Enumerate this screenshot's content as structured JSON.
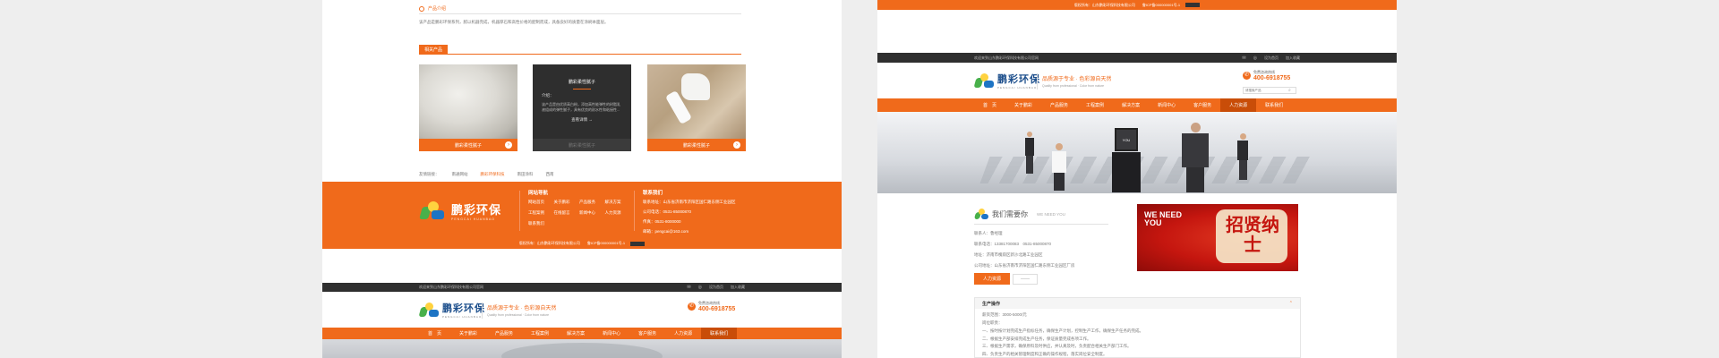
{
  "colors": {
    "brand_orange": "#f06a1b",
    "dark_orange": "#c94d08",
    "topbar": "#2f2f2f",
    "green": "#48b04a",
    "blue": "#1d74c4",
    "red": "#d9261c"
  },
  "left": {
    "section_title": "产品介绍",
    "section_text": "该产品是鹏彩环保系列，腻以机器完成，机器厚石和高性价格的配制而成，具备良好的质量在涂刷本面层。",
    "related_title": "相关产品",
    "products": [
      {
        "label": "鹏彩柔性腻子",
        "icon": "arrow-right-icon"
      },
      {
        "title": "鹏彩柔性腻子",
        "intro": "介绍：",
        "desc": "该产品是由优质高白粉，添加高性能弹性的树脂乳液组成的弹性腻子，具有优良的耐水性和粘接性...",
        "more": "查看详情 →",
        "label": "鹏彩柔性腻子"
      },
      {
        "label": "鹏彩柔性腻子",
        "icon": "arrow-right-icon"
      }
    ],
    "breadcrumb": [
      "友情链接：",
      "南通网站",
      "鹏彩环保科技",
      "南田涂料",
      "西南"
    ],
    "footer": {
      "logo_text": "鹏彩环保",
      "logo_sub": "PENGCAI HUANBAO",
      "nav_title": "网站导航",
      "nav_links": [
        "网站首页",
        "关于鹏彩",
        "产品服务",
        "解决方案",
        "工程案例",
        "在线留言",
        "新闻中心",
        "人力资源",
        "联系我们"
      ],
      "contact_title": "联系我们",
      "contact_lines": [
        "联系地址：山东省济南市济阳区国仁路东侧工业园区",
        "公司电话：0531-85000870",
        "传真：0531-8000000",
        "邮箱：pengcai@163.com"
      ],
      "copyright": "版权所有：山东鹏彩环保科技有限公司　　鲁ICP备000000001号-1"
    },
    "header": {
      "top_left": "欢迎来到山东鹏彩环保科技有限公司官网",
      "top_right": [
        "设为首页",
        "加入收藏"
      ],
      "logo_text": "鹏彩环保",
      "logo_sub": "PENGCAI HUANBAO",
      "slogan": "品质源于专业 · 色彩源自天然",
      "slogan_sub": "Quality from professional · Color from nature",
      "hotline_label": "免费咨询热线",
      "hotline": "400-6918755",
      "nav": [
        "首　页",
        "关于鹏彩",
        "产品服务",
        "工程案例",
        "解决方案",
        "新闻中心",
        "客户服务",
        "人力资源",
        "联系我们"
      ],
      "active_nav": 8
    }
  },
  "right": {
    "top_copyright": "版权所有：山东鹏彩环保科技有限公司　　鲁ICP备000000001号-1",
    "header": {
      "top_left": "欢迎来到山东鹏彩环保科技有限公司官网",
      "top_right": [
        "设为首页",
        "加入收藏"
      ],
      "logo_text": "鹏彩环保",
      "logo_sub": "PENGCAI HUANBAO",
      "slogan": "品质源于专业 · 色彩源自天然",
      "slogan_sub": "Quality from professional · Color from nature",
      "hotline_label": "免费咨询热线",
      "hotline": "400-6918755",
      "search_placeholder": "请搜索产品",
      "nav": [
        "首　页",
        "关于鹏彩",
        "产品服务",
        "工程案例",
        "解决方案",
        "新闻中心",
        "客户服务",
        "人力资源",
        "联系我们"
      ],
      "active_nav": 7
    },
    "need": {
      "title": "我们需要你",
      "title_en": "WE NEED YOU",
      "lines": [
        "联系人：鲁经理",
        "联系电话：13381700083　0531-85000870",
        "地址：济南市槐荫区新沙北路工业园区",
        "公司地址：山东省济南市济阳区国仁路东侧工业园区厂房",
        "WE NEED YOU",
        "招贤纳士"
      ],
      "tab_active": "人力资源",
      "tab_other": "——",
      "job_title": "生产操作",
      "job_lines": [
        "薪资范围：3000-5000/元",
        "岗位职责：",
        "一、按时按计划完成生产指标任务，确保生产计划，控制生产工作，确保生产任务的完成。",
        "二、根据生产部安排完成生产任务，保证质量完成各项工作。",
        "三、根据生产需求，确保原料及时供应，并认真及时，负责配合相关生产部门工作。",
        "四、负责生产的相关管理制度和正确的操作规程，落实岗位安全制度。"
      ]
    }
  }
}
